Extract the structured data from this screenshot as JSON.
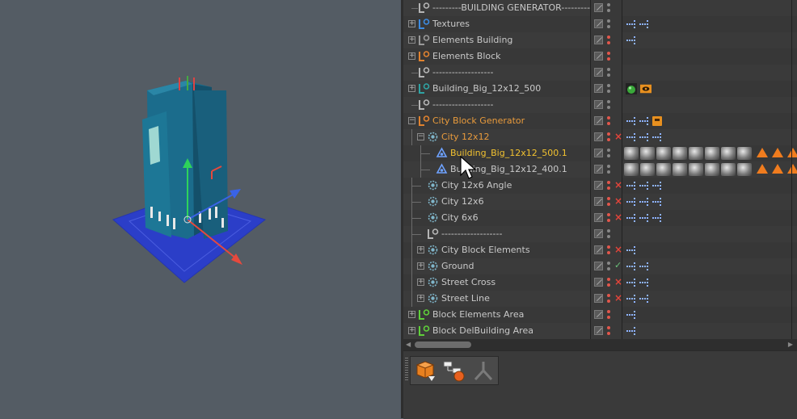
{
  "viewport": {
    "name": "3D viewport"
  },
  "object_manager": {
    "rows": [
      {
        "label": "---------BUILDING GENERATOR---------",
        "indent": 0,
        "icon": "null-icon",
        "icon_color": "#b5b5b5",
        "color": "normal",
        "expander": "none",
        "dots": [
          "#888",
          "#888"
        ],
        "mark": "",
        "tags": []
      },
      {
        "label": "Textures",
        "indent": 0,
        "icon": "null-icon",
        "icon_color": "#3d8be0",
        "color": "normal",
        "expander": "plus",
        "dots": [
          "#888",
          "#888"
        ],
        "mark": "",
        "tags": [
          "dots",
          "dots"
        ]
      },
      {
        "label": "Elements Building",
        "indent": 0,
        "icon": "null-icon",
        "icon_color": "#9a9a9a",
        "color": "normal",
        "expander": "plus",
        "dots": [
          "#e2574c",
          "#e2574c"
        ],
        "mark": "",
        "tags": [
          "dots"
        ]
      },
      {
        "label": "Elements Block",
        "indent": 0,
        "icon": "null-icon",
        "icon_color": "#e0822f",
        "color": "normal",
        "expander": "plus",
        "dots": [
          "#e2574c",
          "#e2574c"
        ],
        "mark": "",
        "tags": []
      },
      {
        "label": "-------------------",
        "indent": 0,
        "icon": "null-icon",
        "icon_color": "#b5b5b5",
        "color": "normal",
        "expander": "none",
        "dots": [
          "#888",
          "#888"
        ],
        "mark": "",
        "tags": []
      },
      {
        "label": "Building_Big_12x12_500",
        "indent": 0,
        "icon": "null-icon",
        "icon_color": "#2fa3a3",
        "color": "normal",
        "expander": "plus",
        "dots": [
          "#888",
          "#888"
        ],
        "mark": "",
        "tags": [
          "green-sphere",
          "eye"
        ]
      },
      {
        "label": "-------------------",
        "indent": 0,
        "icon": "null-icon",
        "icon_color": "#b5b5b5",
        "color": "normal",
        "expander": "none",
        "dots": [
          "#888",
          "#888"
        ],
        "mark": "",
        "tags": []
      },
      {
        "label": "City Block Generator",
        "indent": 0,
        "icon": "null-icon",
        "icon_color": "#e0822f",
        "color": "orange",
        "expander": "minus",
        "dots": [
          "#e2574c",
          "#e2574c"
        ],
        "mark": "",
        "tags": [
          "dots",
          "dots",
          "orange-tag"
        ]
      },
      {
        "label": "City 12x12",
        "indent": 1,
        "icon": "generator-icon",
        "icon_color": "#7fb5c9",
        "color": "orange",
        "expander": "minus",
        "dots": [
          "#e2574c",
          "#e2574c"
        ],
        "mark": "x",
        "tags": [
          "dots",
          "dots",
          "dots"
        ]
      },
      {
        "label": "Building_Big_12x12_500.1",
        "indent": 2,
        "icon": "instance-icon",
        "icon_color": "#6ea2ff",
        "color": "yellow",
        "expander": "none",
        "dots": [
          "#888",
          "#888"
        ],
        "mark": "",
        "tags": [
          "materials",
          "warnings"
        ]
      },
      {
        "label": "Building_Big_12x12_400.1",
        "indent": 2,
        "icon": "instance-icon",
        "icon_color": "#6ea2ff",
        "color": "normal",
        "expander": "none",
        "dots": [
          "#888",
          "#888"
        ],
        "mark": "",
        "tags": [
          "materials",
          "warnings"
        ]
      },
      {
        "label": "City 12x6 Angle",
        "indent": 1,
        "icon": "generator-icon",
        "icon_color": "#7fb5c9",
        "color": "normal",
        "expander": "none",
        "dots": [
          "#e2574c",
          "#e2574c"
        ],
        "mark": "x",
        "tags": [
          "dots",
          "dots",
          "dots"
        ]
      },
      {
        "label": "City 12x6",
        "indent": 1,
        "icon": "generator-icon",
        "icon_color": "#7fb5c9",
        "color": "normal",
        "expander": "none",
        "dots": [
          "#e2574c",
          "#e2574c"
        ],
        "mark": "x",
        "tags": [
          "dots",
          "dots",
          "dots"
        ]
      },
      {
        "label": "City 6x6",
        "indent": 1,
        "icon": "generator-icon",
        "icon_color": "#7fb5c9",
        "color": "normal",
        "expander": "none",
        "dots": [
          "#e2574c",
          "#e2574c"
        ],
        "mark": "x",
        "tags": [
          "dots",
          "dots",
          "dots"
        ]
      },
      {
        "label": "-------------------",
        "indent": 1,
        "icon": "null-icon",
        "icon_color": "#b5b5b5",
        "color": "normal",
        "expander": "none",
        "dots": [
          "#888",
          "#888"
        ],
        "mark": "",
        "tags": []
      },
      {
        "label": "City Block Elements",
        "indent": 1,
        "icon": "generator-icon",
        "icon_color": "#7fb5c9",
        "color": "normal",
        "expander": "plus",
        "dots": [
          "#e2574c",
          "#e2574c"
        ],
        "mark": "x",
        "tags": [
          "dots"
        ]
      },
      {
        "label": "Ground",
        "indent": 1,
        "icon": "generator-icon",
        "icon_color": "#7fb5c9",
        "color": "normal",
        "expander": "plus",
        "dots": [
          "#888",
          "#888"
        ],
        "mark": "check",
        "tags": [
          "dots",
          "dots"
        ]
      },
      {
        "label": "Street Cross",
        "indent": 1,
        "icon": "generator-icon",
        "icon_color": "#7fb5c9",
        "color": "normal",
        "expander": "plus",
        "dots": [
          "#e2574c",
          "#e2574c"
        ],
        "mark": "x",
        "tags": [
          "dots",
          "dots"
        ]
      },
      {
        "label": "Street Line",
        "indent": 1,
        "icon": "generator-icon",
        "icon_color": "#7fb5c9",
        "color": "normal",
        "expander": "plus",
        "dots": [
          "#e2574c",
          "#e2574c"
        ],
        "mark": "x",
        "tags": [
          "dots",
          "dots"
        ]
      },
      {
        "label": "Block Elements Area",
        "indent": 0,
        "icon": "null-icon",
        "icon_color": "#5fcf3a",
        "color": "normal",
        "expander": "plus",
        "dots": [
          "#e2574c",
          "#e2574c"
        ],
        "mark": "",
        "tags": [
          "dots"
        ]
      },
      {
        "label": "Block DelBuilding Area",
        "indent": 0,
        "icon": "null-icon",
        "icon_color": "#5fcf3a",
        "color": "normal",
        "expander": "plus",
        "dots": [
          "#e2574c",
          "#e2574c"
        ],
        "mark": "",
        "tags": [
          "dots"
        ]
      }
    ]
  },
  "toolbar": {
    "buttons": [
      {
        "name": "cube-move-tool-icon"
      },
      {
        "name": "hierarchy-tool-icon"
      },
      {
        "name": "joint-tool-icon"
      }
    ]
  }
}
